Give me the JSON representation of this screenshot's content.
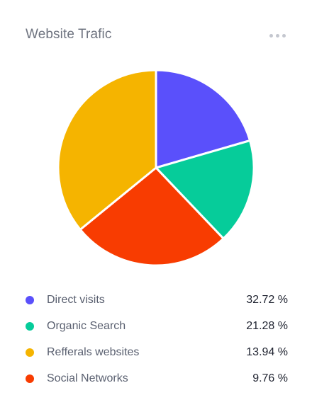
{
  "header": {
    "title": "Website Trafic",
    "menu_icon": "more-horizontal-icon"
  },
  "chart_data": {
    "type": "pie",
    "title": "Website Trafic",
    "slices": [
      {
        "label": "Direct visits",
        "percent": 20.5,
        "color": "#5a50fb"
      },
      {
        "label": "Organic Search",
        "percent": 17.4,
        "color": "#06cc9a"
      },
      {
        "label": "Social Networks",
        "percent": 26.2,
        "color": "#f83c01"
      },
      {
        "label": "Refferals websites",
        "percent": 35.9,
        "color": "#f5b400"
      }
    ]
  },
  "legend": {
    "items": [
      {
        "label": "Direct visits",
        "value": "32.72 %",
        "color": "#5a50fb"
      },
      {
        "label": "Organic Search",
        "value": "21.28 %",
        "color": "#06cc9a"
      },
      {
        "label": "Refferals websites",
        "value": "13.94 %",
        "color": "#f5b400"
      },
      {
        "label": "Social Networks",
        "value": "9.76 %",
        "color": "#f83c01"
      }
    ]
  }
}
